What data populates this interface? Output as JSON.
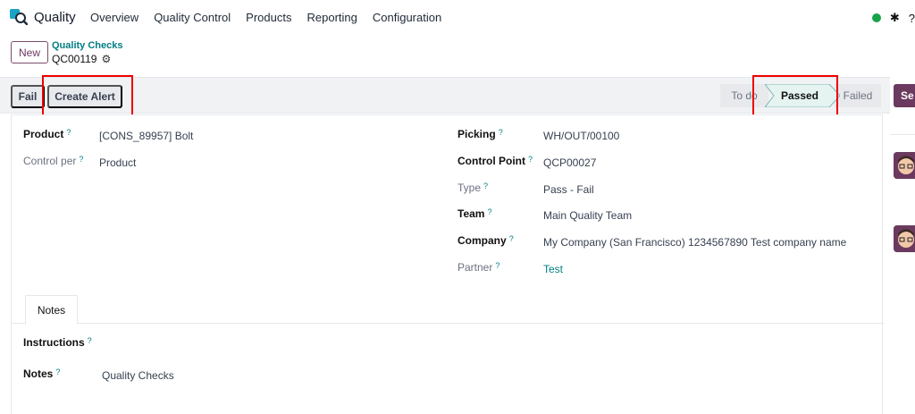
{
  "topnav": {
    "app_name": "Quality",
    "menu": [
      "Overview",
      "Quality Control",
      "Products",
      "Reporting",
      "Configuration"
    ],
    "status_color": "#16a34a"
  },
  "control_panel": {
    "new_label": "New",
    "breadcrumb_parent": "Quality Checks",
    "breadcrumb_current": "QC00119"
  },
  "statusbar": {
    "fail_label": "Fail",
    "create_alert_label": "Create Alert",
    "stages": [
      "To do",
      "Passed",
      "Failed"
    ],
    "active_stage": "Passed",
    "send_label": "Se"
  },
  "form": {
    "left": [
      {
        "label": "Product",
        "value": "[CONS_89957] Bolt"
      },
      {
        "label": "Control per",
        "value": "Product"
      }
    ],
    "right": [
      {
        "label": "Picking",
        "value": "WH/OUT/00100"
      },
      {
        "label": "Control Point",
        "value": "QCP00027"
      },
      {
        "label": "Type",
        "value": "Pass - Fail"
      },
      {
        "label": "Team",
        "value": "Main Quality Team"
      },
      {
        "label": "Company",
        "value": "My Company (San Francisco) 1234567890 Test company name"
      },
      {
        "label": "Partner",
        "value": "Test"
      }
    ],
    "help_mark": "?"
  },
  "tabs": {
    "notes_label": "Notes"
  },
  "notes_tab": {
    "instructions_label": "Instructions",
    "notes_label": "Notes",
    "notes_value": "Quality Checks"
  },
  "colors": {
    "accent": "#017e84",
    "brand": "#6b3a5e",
    "highlight": "#e00000"
  }
}
